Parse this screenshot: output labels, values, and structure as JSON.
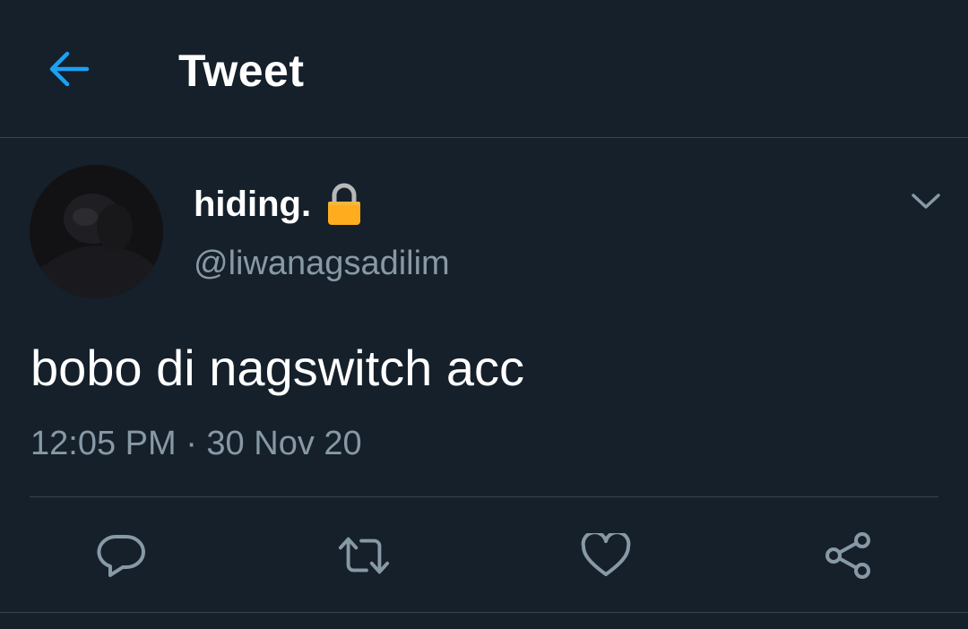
{
  "header": {
    "title": "Tweet",
    "back_icon": "arrow-left-icon"
  },
  "colors": {
    "background": "#15202b",
    "accent": "#1da1f2",
    "secondary_text": "#8899a6",
    "divider": "#38444d",
    "lock": "#ffad1f"
  },
  "tweet": {
    "author": {
      "display_name": "hiding.",
      "handle": "@liwanagsadilim",
      "protected_icon": "lock-icon"
    },
    "text": "bobo di nagswitch acc",
    "timestamp": "12:05 PM · 30 Nov 20"
  },
  "actions": [
    {
      "name": "reply",
      "icon": "reply-icon"
    },
    {
      "name": "retweet",
      "icon": "retweet-icon"
    },
    {
      "name": "like",
      "icon": "heart-icon"
    },
    {
      "name": "share",
      "icon": "share-icon"
    }
  ]
}
